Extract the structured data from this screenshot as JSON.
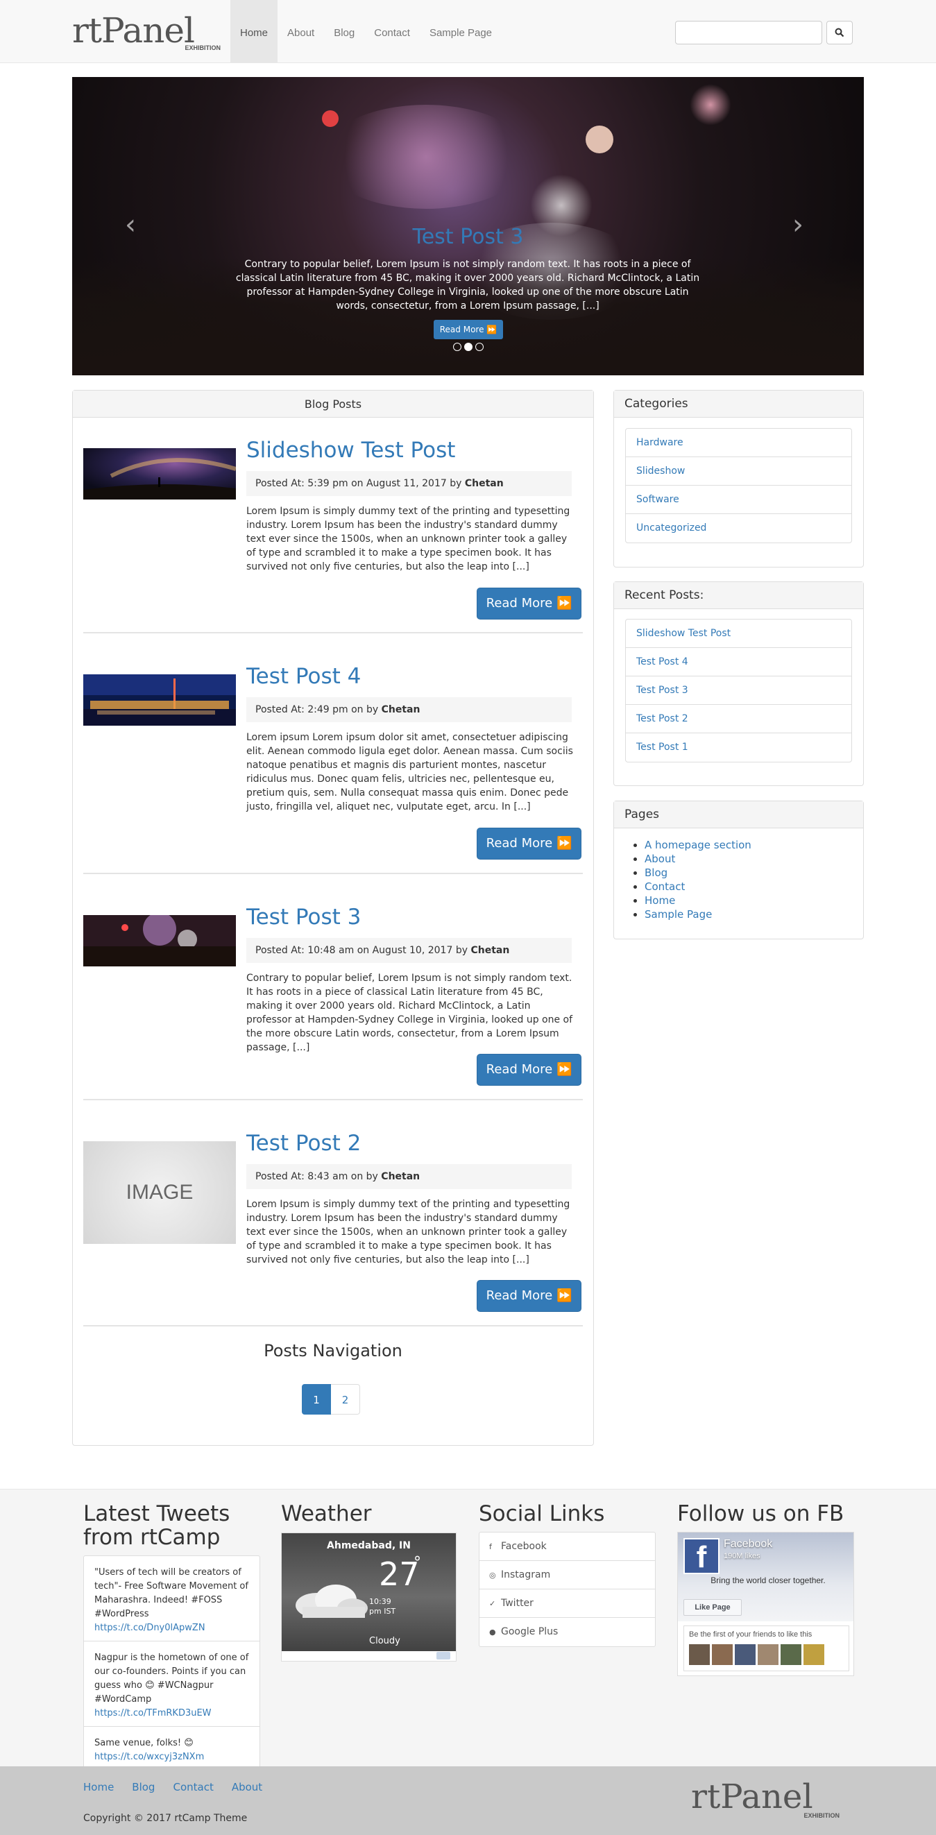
{
  "header": {
    "logo_text": "rtPanel",
    "logo_sub": "EXHIBITION",
    "nav": [
      "Home",
      "About",
      "Blog",
      "Contact",
      "Sample Page"
    ],
    "active_nav": "Home",
    "search_placeholder": "",
    "search_icon": "search-icon"
  },
  "hero": {
    "title": "Test Post 3",
    "text": "Contrary to popular belief, Lorem Ipsum is not simply random text. It has roots in a piece of classical Latin literature from 45 BC, making it over 2000 years old. Richard McClintock, a Latin professor at Hampden-Sydney College in Virginia, looked up one of the more obscure Latin words, consectetur, from a Lorem Ipsum passage, [...]",
    "button": "Read More",
    "prev_glyph": "‹",
    "next_glyph": "›",
    "active_slide": 2,
    "slide_count": 3
  },
  "blog": {
    "heading": "Blog Posts",
    "posts": [
      {
        "title": "Slideshow Test Post",
        "meta_prefix": "Posted At: 5:39 pm on August 11, 2017 by ",
        "author": "Chetan",
        "excerpt": "Lorem Ipsum is simply dummy text of the printing and typesetting industry. Lorem Ipsum has been the industry's standard dummy text ever since the 1500s, when an unknown printer took a galley of type and scrambled it to make a type specimen book. It has survived not only five centuries, but also the leap into [...]",
        "read_more": "Read More"
      },
      {
        "title": "Test Post 4",
        "meta_prefix": "Posted At: 2:49 pm on by ",
        "author": "Chetan",
        "excerpt": "Lorem ipsum Lorem ipsum dolor sit amet, consectetuer adipiscing elit. Aenean commodo ligula eget dolor. Aenean massa. Cum sociis natoque penatibus et magnis dis parturient montes, nascetur ridiculus mus. Donec quam felis, ultricies nec, pellentesque eu, pretium quis, sem. Nulla consequat massa quis enim. Donec pede justo, fringilla vel, aliquet nec, vulputate eget, arcu. In [...]",
        "read_more": "Read More"
      },
      {
        "title": "Test Post 3",
        "meta_prefix": "Posted At: 10:48 am on August 10, 2017 by ",
        "author": "Chetan",
        "excerpt": "Contrary to popular belief, Lorem Ipsum is not simply random text. It has roots in a piece of classical Latin literature from 45 BC, making it over 2000 years old. Richard McClintock, a Latin professor at Hampden-Sydney College in Virginia, looked up one of the more obscure Latin words, consectetur, from a Lorem Ipsum passage, [...]",
        "read_more": "Read More"
      },
      {
        "title": "Test Post 2",
        "meta_prefix": "Posted At: 8:43 am on by ",
        "author": "Chetan",
        "excerpt": "Lorem Ipsum is simply dummy text of the printing and typesetting industry. Lorem Ipsum has been the industry's standard dummy text ever since the 1500s, when an unknown printer took a galley of type and scrambled it to make a type specimen book. It has survived not only five centuries, but also the leap into [...]",
        "read_more": "Read More",
        "image_label": "IMAGE"
      }
    ],
    "posts_navigation": "Posts Navigation",
    "pages": [
      "1",
      "2"
    ],
    "current_page": "1"
  },
  "sidebar": {
    "categories": {
      "heading": "Categories",
      "items": [
        "Hardware",
        "Slideshow",
        "Software",
        "Uncategorized"
      ]
    },
    "recent": {
      "heading": "Recent Posts:",
      "items": [
        "Slideshow Test Post",
        "Test Post 4",
        "Test Post 3",
        "Test Post 2",
        "Test Post 1"
      ]
    },
    "pages": {
      "heading": "Pages",
      "items": [
        "A homepage section",
        "About",
        "Blog",
        "Contact",
        "Home",
        "Sample Page"
      ]
    }
  },
  "footer_widgets": {
    "tweets": {
      "heading": "Latest Tweets from rtCamp",
      "items": [
        {
          "text": "\"Users of tech will be creators of tech\"- Free Software Movement of Maharashra. Indeed! #FOSS #WordPress",
          "link": "https://t.co/Dny0lApwZN"
        },
        {
          "text": "Nagpur is the hometown of one of our co-founders. Points if you can guess who 😊 #WCNagpur #WordCamp",
          "link": "https://t.co/TFmRKD3uEW"
        },
        {
          "text": "Same venue, folks! 😊",
          "link": "https://t.co/wxcyj3zNXm"
        }
      ]
    },
    "weather": {
      "heading": "Weather",
      "city": "Ahmedabad, IN",
      "temp": "27",
      "deg": "°",
      "time": "10:39 pm IST",
      "condition": "Cloudy"
    },
    "social": {
      "heading": "Social Links",
      "items": [
        {
          "label": "Facebook",
          "icon": "facebook-icon",
          "glyph": "f"
        },
        {
          "label": "Instagram",
          "icon": "instagram-icon",
          "glyph": "◎"
        },
        {
          "label": "Twitter",
          "icon": "twitter-icon",
          "glyph": "✓"
        },
        {
          "label": "Google Plus",
          "icon": "google-plus-icon",
          "glyph": "●"
        }
      ]
    },
    "facebook": {
      "heading": "Follow us on FB",
      "page_name": "Facebook",
      "likes": "190M likes",
      "slogan": "Bring the world closer together.",
      "like_button": "Like Page",
      "friends_text": "Be the first of your friends to like this"
    }
  },
  "footer": {
    "nav": [
      "Home",
      "Blog",
      "Contact",
      "About"
    ],
    "copyright": "Copyright © 2017 rtCamp Theme",
    "logo_text": "rtPanel",
    "logo_sub": "EXHIBITION"
  },
  "colors": {
    "link": "#337ab7",
    "button": "#337ab7",
    "footer_bg": "#c9c9c9"
  }
}
